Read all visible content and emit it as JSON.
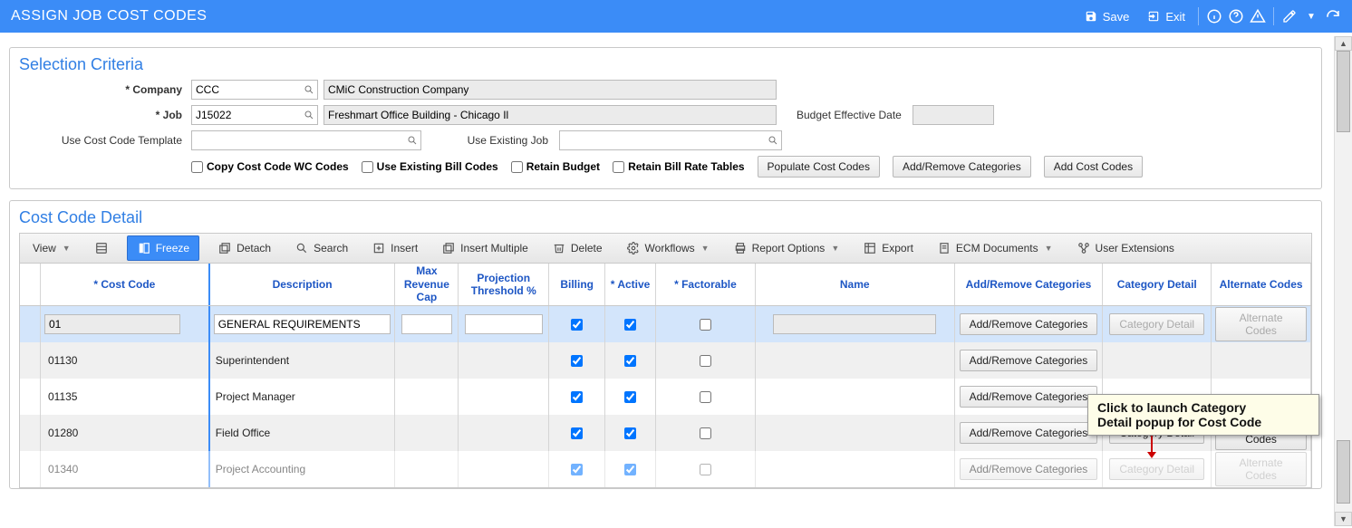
{
  "header": {
    "title": "ASSIGN JOB COST CODES",
    "save": "Save",
    "exit": "Exit"
  },
  "selection": {
    "title": "Selection Criteria",
    "company_label": "* Company",
    "company_value": "CCC",
    "company_name": "CMiC Construction Company",
    "job_label": "* Job",
    "job_value": "J15022",
    "job_name": "Freshmart Office Building - Chicago Il",
    "budget_date_label": "Budget Effective Date",
    "budget_date_value": "",
    "use_template_label": "Use Cost Code Template",
    "use_template_value": "",
    "use_existing_label": "Use Existing Job",
    "use_existing_value": "",
    "cb_copy_wc": "Copy Cost Code WC Codes",
    "cb_use_existing_bill": "Use Existing Bill Codes",
    "cb_retain_budget": "Retain Budget",
    "cb_retain_bill_rate": "Retain Bill Rate Tables",
    "btn_populate": "Populate Cost Codes",
    "btn_addremove": "Add/Remove Categories",
    "btn_addcodes": "Add Cost Codes"
  },
  "detail": {
    "title": "Cost Code Detail",
    "toolbar": {
      "view": "View",
      "freeze": "Freeze",
      "detach": "Detach",
      "search": "Search",
      "insert": "Insert",
      "insert_multiple": "Insert Multiple",
      "delete": "Delete",
      "workflows": "Workflows",
      "report_options": "Report Options",
      "export": "Export",
      "ecm": "ECM Documents",
      "user_ext": "User Extensions"
    },
    "columns": {
      "cost_code": "* Cost Code",
      "description": "Description",
      "max_rev": "Max Revenue Cap",
      "proj_thresh": "Projection Threshold %",
      "billing": "Billing",
      "active": "* Active",
      "factorable": "* Factorable",
      "name": "Name",
      "addremove": "Add/Remove Categories",
      "catdetail": "Category Detail",
      "altcodes": "Alternate Codes"
    },
    "buttons": {
      "addremove": "Add/Remove Categories",
      "catdetail": "Category Detail",
      "altcodes": "Alternate Codes"
    },
    "rows": [
      {
        "code": "01",
        "desc": "GENERAL REQUIREMENTS",
        "max": "",
        "proj": "",
        "billing": true,
        "active": true,
        "factorable": false,
        "name": "",
        "selected": true,
        "editable": true,
        "catdetail_enabled": false,
        "altcodes_enabled": false
      },
      {
        "code": "01130",
        "desc": "Superintendent",
        "billing": true,
        "active": true,
        "factorable": false,
        "catdetail_enabled": true,
        "altcodes_visible": false
      },
      {
        "code": "01135",
        "desc": "Project Manager",
        "billing": true,
        "active": true,
        "factorable": false,
        "catdetail_enabled": true,
        "altcodes_visible": false
      },
      {
        "code": "01280",
        "desc": "Field Office",
        "billing": true,
        "active": true,
        "factorable": false,
        "catdetail_enabled": true,
        "altcodes_enabled": true
      },
      {
        "code": "01340",
        "desc": "Project Accounting",
        "billing": true,
        "active": true,
        "factorable": false,
        "catdetail_enabled": false,
        "altcodes_enabled": false,
        "faded": true
      }
    ]
  },
  "tooltip": {
    "line1": "Click to launch Category",
    "line2": "Detail popup for Cost Code"
  }
}
